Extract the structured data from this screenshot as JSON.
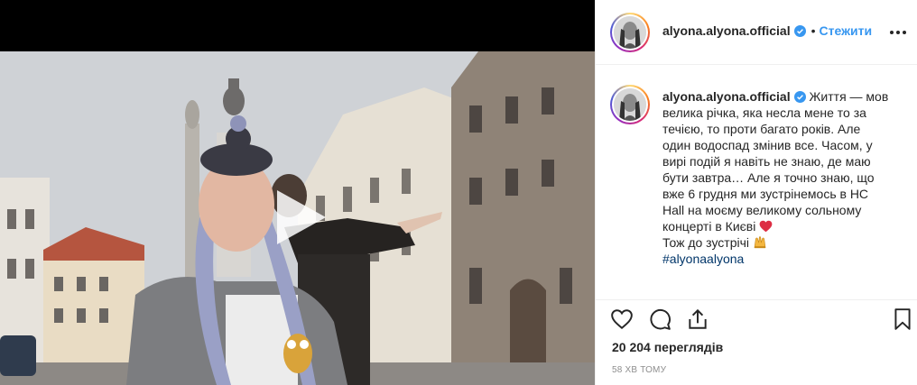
{
  "post": {
    "username": "alyona.alyona.official",
    "follow_label": "Стежити",
    "dot": "•",
    "caption_lines": [
      "Життя — мов",
      "велика річка, яка несла мене то за",
      "течією, то проти багато років. Але",
      "один водоспад змінив все. Часом, у",
      "вирі подій я навіть не знаю, де маю",
      "бути завтра… Але я точно знаю, що",
      "вже 6 грудня ми зустрінемось в НС",
      "Hall на моєму великому сольному",
      "концерті в Києві"
    ],
    "caption_last_line": "Тож до зустрічі",
    "hashtag": "#alyonaalyona",
    "views": "20 204 переглядів",
    "time": "58 ХВ ТОМУ"
  },
  "icons": {
    "heart": "heart-icon",
    "comment": "comment-icon",
    "share": "share-icon",
    "bookmark": "bookmark-icon",
    "more": "more-icon",
    "play": "play-icon",
    "verified": "verified-badge-icon",
    "emoji_heart": "red-heart-emoji",
    "emoji_hands": "raising-hands-emoji"
  },
  "colors": {
    "follow": "#3897f0",
    "hashtag": "#003569",
    "verified": "#3897f0",
    "text": "#262626",
    "muted": "#8e8e8e"
  }
}
